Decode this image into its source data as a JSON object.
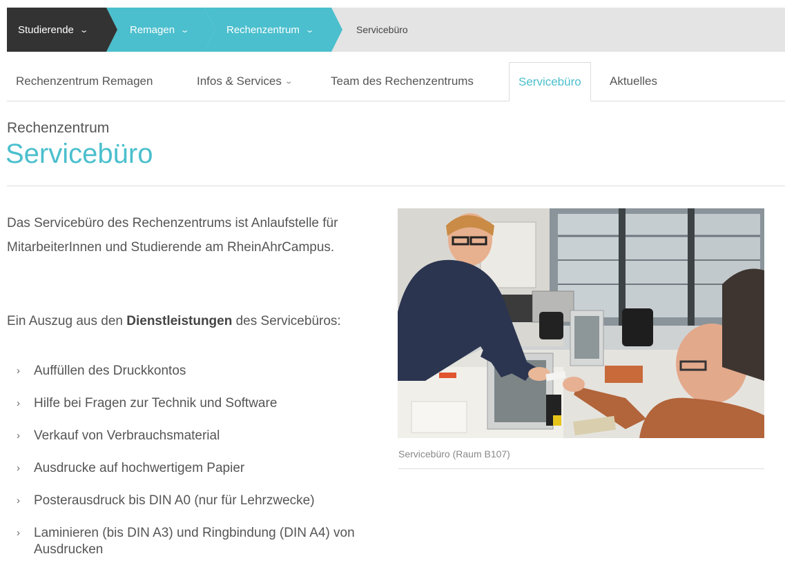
{
  "breadcrumb": {
    "items": [
      {
        "label": "Studierende"
      },
      {
        "label": "Remagen"
      },
      {
        "label": "Rechenzentrum"
      }
    ],
    "current": "Servicebüro",
    "chevron": "⌄"
  },
  "subnav": {
    "items": [
      {
        "label": "Rechenzentrum Remagen"
      },
      {
        "label": "Infos & Services"
      },
      {
        "label": "Team des Rechenzentrums"
      },
      {
        "label": "Servicebüro"
      },
      {
        "label": "Aktuelles"
      }
    ]
  },
  "page": {
    "kicker": "Rechenzentrum",
    "title": "Servicebüro"
  },
  "content": {
    "intro": "Das Servicebüro des Rechenzentrums ist Anlaufstelle für MitarbeiterInnen und Studierende am RheinAhrCampus.",
    "lead_before": "Ein Auszug aus den ",
    "lead_bold": "Dienstleistungen",
    "lead_after": " des Servicebüros:",
    "list_marker": "›",
    "services": [
      "Auffüllen des Druckkontos",
      "Hilfe bei Fragen zur Technik und Software",
      "Verkauf von Verbrauchsmaterial",
      "Ausdrucke auf hochwertigem Papier",
      "Posterausdruck bis DIN A0 (nur für Lehrzwecke)",
      "Laminieren (bis DIN A3) und Ringbindung (DIN A4) von Ausdrucken"
    ]
  },
  "figure": {
    "caption": "Servicebüro (Raum B107)"
  },
  "colors": {
    "accent": "#4bbfcd",
    "dark": "#333333",
    "text": "#555555"
  }
}
